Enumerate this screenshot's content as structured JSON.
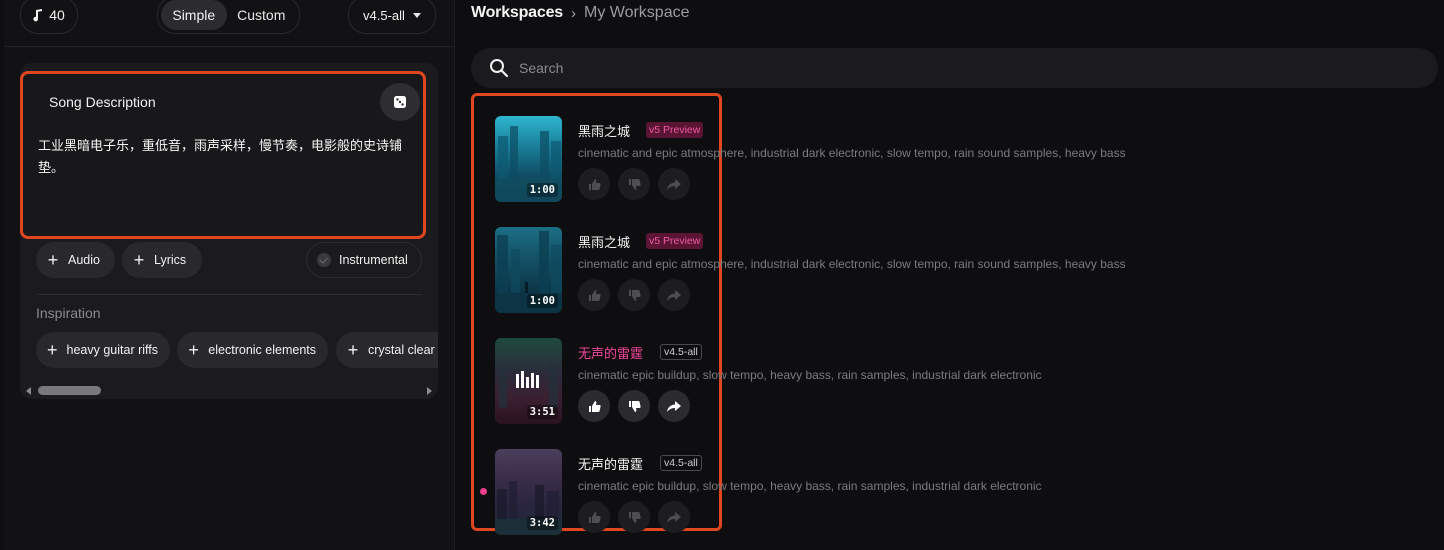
{
  "colors": {
    "accent_highlight": "#e0461f",
    "pink": "#f2449a",
    "badge_v5_bg": "#5a1535",
    "background": "#0e0e10",
    "panel": "#121214"
  },
  "left_panel": {
    "credits": {
      "icon": "music-note-icon",
      "value": "40"
    },
    "mode_toggle": {
      "simple": "Simple",
      "custom": "Custom",
      "selected": "Simple"
    },
    "model_select": {
      "value": "v4.5-all",
      "icon": "caret-down-icon"
    },
    "description": {
      "label": "Song Description",
      "dice_icon": "dice-icon",
      "text": "工业黑暗电子乐，重低音，雨声采样，慢节奏，电影般的史诗铺垫。"
    },
    "add_buttons": {
      "audio": "Audio",
      "lyrics": "Lyrics"
    },
    "instrumental": {
      "label": "Instrumental",
      "checked": false
    },
    "inspiration": {
      "label": "Inspiration",
      "chips": [
        "heavy guitar riffs",
        "electronic elements",
        "crystal clear"
      ]
    }
  },
  "workspace": {
    "breadcrumb": {
      "root": "Workspaces",
      "separator": "›",
      "current": "My Workspace"
    },
    "search": {
      "placeholder": "Search",
      "icon": "search-icon"
    },
    "songs": [
      {
        "title": "黑雨之城",
        "title_highlight": false,
        "badge": "v5 Preview",
        "tags": "cinematic and epic atmosphere, industrial dark electronic, slow tempo, rain sound samples, heavy bass",
        "duration": "1:00",
        "playing": false
      },
      {
        "title": "黑雨之城",
        "title_highlight": false,
        "badge": "v5 Preview",
        "tags": "cinematic and epic atmosphere, industrial dark electronic, slow tempo, rain sound samples, heavy bass",
        "duration": "1:00",
        "playing": false
      },
      {
        "title": "无声的雷霆",
        "title_highlight": true,
        "badge": "v4.5-all",
        "tags": "cinematic epic buildup, slow tempo, heavy bass, rain samples, industrial dark electronic",
        "duration": "3:51",
        "playing": true
      },
      {
        "title": "无声的雷霆",
        "title_highlight": false,
        "badge": "v4.5-all",
        "tags": "cinematic epic buildup, slow tempo, heavy bass, rain samples, industrial dark electronic",
        "duration": "3:42",
        "playing": false
      }
    ],
    "action_icons": [
      "thumbs-up-icon",
      "thumbs-down-icon",
      "share-icon"
    ]
  }
}
